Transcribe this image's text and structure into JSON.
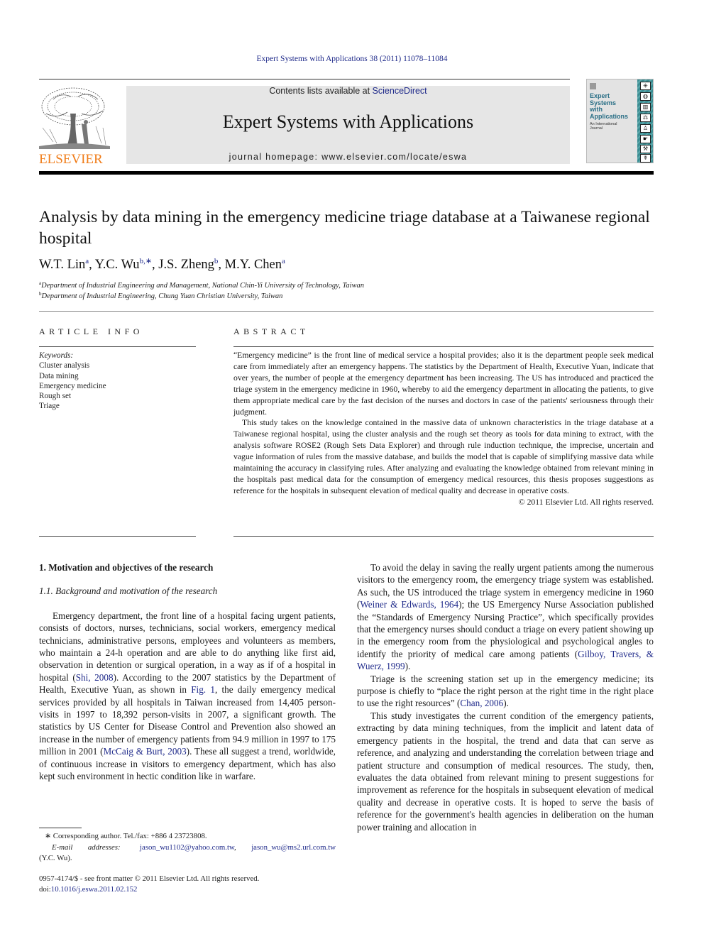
{
  "journal_citation": "Expert Systems with Applications 38 (2011) 11078–11084",
  "header": {
    "publisher_logo_text": "ELSEVIER",
    "contents_prefix": "Contents lists available at ",
    "contents_link": "ScienceDirect",
    "journal_title": "Expert Systems with Applications",
    "homepage": "journal homepage: www.elsevier.com/locate/eswa",
    "cover": {
      "title_lines": [
        "Expert",
        "Systems",
        "with",
        "Applications"
      ],
      "subtitle_lines": [
        "An International",
        "Journal"
      ]
    }
  },
  "colors": {
    "link": "#1f2a8a",
    "elsevier_orange": "#f07d1a",
    "banner_gray": "#e6e6e6",
    "cover_teal": "#3c8d92"
  },
  "article": {
    "title": "Analysis by data mining in the emergency medicine triage database at a Taiwanese regional hospital",
    "authors": [
      {
        "name": "W.T. Lin",
        "sup": "a",
        "sep": ", "
      },
      {
        "name": "Y.C. Wu",
        "sup": "b,∗",
        "sep": ", "
      },
      {
        "name": "J.S. Zheng",
        "sup": "b",
        "sep": ", "
      },
      {
        "name": "M.Y. Chen",
        "sup": "a",
        "sep": ""
      }
    ],
    "affiliations": [
      {
        "mark": "a",
        "text": "Department of Industrial Engineering and Management, National Chin-Yi University of Technology, Taiwan"
      },
      {
        "mark": "b",
        "text": "Department of Industrial Engineering, Chung Yuan Christian University, Taiwan"
      }
    ]
  },
  "article_info": {
    "label": "ARTICLE INFO",
    "keywords_label": "Keywords:",
    "keywords": [
      "Cluster analysis",
      "Data mining",
      "Emergency medicine",
      "Rough set",
      "Triage"
    ]
  },
  "abstract": {
    "label": "ABSTRACT",
    "paragraphs": [
      "“Emergency medicine” is the front line of medical service a hospital provides; also it is the department people seek medical care from immediately after an emergency happens. The statistics by the Department of Health, Executive Yuan, indicate that over years, the number of people at the emergency department has been increasing. The US has introduced and practiced the triage system in the emergency medicine in 1960, whereby to aid the emergency department in allocating the patients, to give them appropriate medical care by the fast decision of the nurses and doctors in case of the patients' seriousness through their judgment.",
      "This study takes on the knowledge contained in the massive data of unknown characteristics in the triage database at a Taiwanese regional hospital, using the cluster analysis and the rough set theory as tools for data mining to extract, with the analysis software ROSE2 (Rough Sets Data Explorer) and through rule induction technique, the imprecise, uncertain and vague information of rules from the massive database, and builds the model that is capable of simplifying massive data while maintaining the accuracy in classifying rules. After analyzing and evaluating the knowledge obtained from relevant mining in the hospitals past medical data for the consumption of emergency medical resources, this thesis proposes suggestions as reference for the hospitals in subsequent elevation of medical quality and decrease in operative costs."
    ],
    "copyright": "© 2011 Elsevier Ltd. All rights reserved."
  },
  "body": {
    "section_heading": "1. Motivation and objectives of the research",
    "subsection_heading": "1.1. Background and motivation of the research",
    "left_paragraph": {
      "part1": "Emergency department, the front line of a hospital facing urgent patients, consists of doctors, nurses, technicians, social workers, emergency medical technicians, administrative persons, employees and volunteers as members, who maintain a 24-h operation and are able to do anything like first aid, observation in detention or surgical operation, in a way as if of a hospital in hospital (",
      "ref1": "Shi, 2008",
      "part2": "). According to the 2007 statistics by the Department of Health, Executive Yuan, as shown in ",
      "ref2": "Fig. 1",
      "part3": ", the daily emergency medical services provided by all hospitals in Taiwan increased from 14,405 person-visits in 1997 to 18,392 person-visits in 2007, a significant growth. The statistics by US Center for Disease Control and Prevention also showed an increase in the number of emergency patients from 94.9 million in 1997 to 175 million in 2001 (",
      "ref3": "McCaig & Burt, 2003",
      "part4": "). These all suggest a trend, worldwide, of continuous increase in visitors to emergency department, which has also kept such environment in hectic condition like in warfare."
    },
    "right_paragraphs": {
      "p1_part1": "To avoid the delay in saving the really urgent patients among the numerous visitors to the emergency room, the emergency triage system was established. As such, the US introduced the triage system in emergency medicine in 1960 (",
      "p1_ref1": "Weiner & Edwards, 1964",
      "p1_part2": "); the US Emergency Nurse Association published the “Standards of Emergency Nursing Practice”, which specifically provides that the emergency nurses should conduct a triage on every patient showing up in the emergency room from the physiological and psychological angles to identify the priority of medical care among patients (",
      "p1_ref2": "Gilboy, Travers, & Wuerz, 1999",
      "p1_part3": ").",
      "p2_part1": "Triage is the screening station set up in the emergency medicine; its purpose is chiefly to “place the right person at the right time in the right place to use the right resources” (",
      "p2_ref1": "Chan, 2006",
      "p2_part2": ").",
      "p3": "This study investigates the current condition of the emergency patients, extracting by data mining techniques, from the implicit and latent data of emergency patients in the hospital, the trend and data that can serve as reference, and analyzing and understanding the correlation between triage and patient structure and consumption of medical resources. The study, then, evaluates the data obtained from relevant mining to present suggestions for improvement as reference for the hospitals in subsequent elevation of medical quality and decrease in operative costs. It is hoped to serve the basis of reference for the government's health agencies in deliberation on the human power training and allocation in"
    }
  },
  "footnotes": {
    "corresponding": "∗ Corresponding author. Tel./fax: +886 4 23723808.",
    "email_label": "E-mail addresses:",
    "email1": "jason_wu1102@yahoo.com.tw",
    "email_sep": ", ",
    "email2": "jason_wu@ms2.url.com.tw",
    "email_owner": "(Y.C. Wu).",
    "issn_line": "0957-4174/$ - see front matter © 2011 Elsevier Ltd. All rights reserved.",
    "doi_prefix": "doi:",
    "doi": "10.1016/j.eswa.2011.02.152"
  }
}
